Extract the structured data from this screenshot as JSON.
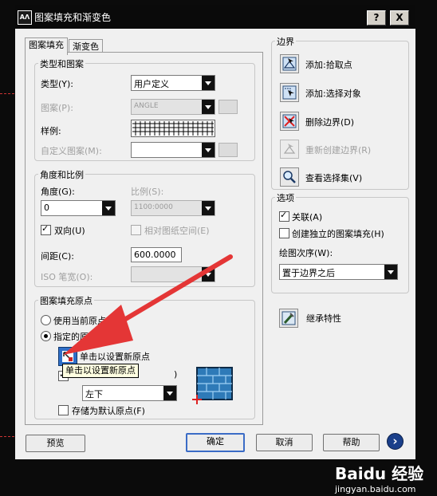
{
  "window": {
    "title": "图案填充和渐变色",
    "help_btn": "?",
    "close_btn": "X"
  },
  "tabs": [
    {
      "label": "图案填充"
    },
    {
      "label": "渐变色"
    }
  ],
  "type_pattern": {
    "title": "类型和图案",
    "type_label": "类型(Y):",
    "type_value": "用户定义",
    "pattern_label": "图案(P):",
    "pattern_value": "ANGLE",
    "swatch_label": "样例:",
    "custom_label": "自定义图案(M):",
    "custom_value": ""
  },
  "angle_scale": {
    "title": "角度和比例",
    "angle_label": "角度(G):",
    "angle_value": "0",
    "scale_label": "比例(S):",
    "scale_value": "1100:0000",
    "double_label": "双向(U)",
    "double_checked": true,
    "paper_label": "相对图纸空间(E)",
    "paper_checked": false,
    "spacing_label": "间距(C):",
    "spacing_value": "600.0000",
    "iso_label": "ISO 笔宽(O):",
    "iso_value": ""
  },
  "origin": {
    "title": "图案填充原点",
    "current_label": "使用当前原点(T)",
    "specified_label": "指定的原点",
    "set_new_label": "单击以设置新原点",
    "tooltip": "单击以设置新原点",
    "default_extent_suffix": ")",
    "position_value": "左下",
    "store_label": "存储为默认原点(F)"
  },
  "boundary": {
    "title": "边界",
    "add_pick": "添加:拾取点",
    "add_select": "添加:选择对象",
    "remove": "删除边界(D)",
    "recreate": "重新创建边界(R)",
    "view": "查看选择集(V)"
  },
  "options": {
    "title": "选项",
    "assoc_label": "关联(A)",
    "assoc_checked": true,
    "separate_label": "创建独立的图案填充(H)",
    "separate_checked": false,
    "draw_order_label": "绘图次序(W):",
    "draw_order_value": "置于边界之后"
  },
  "inherit_label": "继承特性",
  "buttons": {
    "preview": "预览",
    "ok": "确定",
    "cancel": "取消",
    "help": "帮助",
    "more": "›"
  },
  "watermark": {
    "brand": "Baidu 经验",
    "url": "jingyan.baidu.com"
  },
  "colors": {
    "accent": "#e43636",
    "default_border": "#3b6cc6",
    "arrow_btn": "#1a3f8a"
  }
}
